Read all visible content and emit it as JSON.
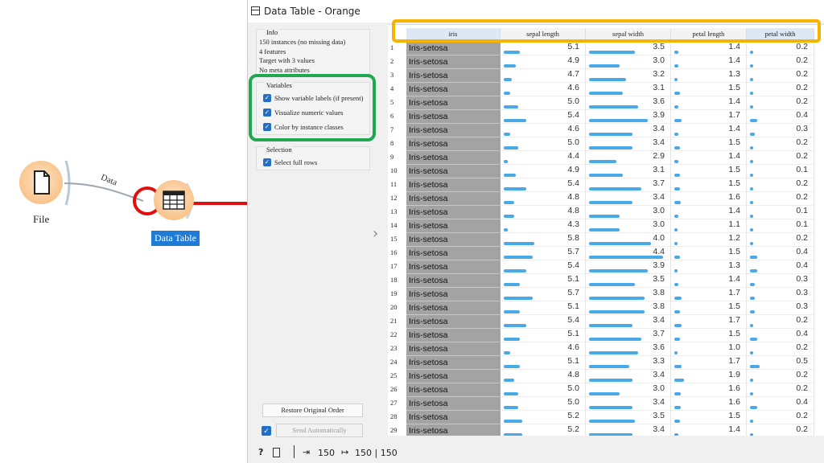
{
  "workflow": {
    "edge_label": "Data",
    "nodes": [
      {
        "label": "File",
        "icon": "file-icon"
      },
      {
        "label": "Data Table",
        "icon": "table-icon"
      }
    ]
  },
  "window": {
    "title": "Data Table - Orange"
  },
  "info": {
    "title": "Info",
    "lines": [
      "150 instances (no missing data)",
      "4 features",
      "Target with 3 values",
      "No meta attributes"
    ]
  },
  "variables": {
    "title": "Variables",
    "options": [
      {
        "label": "Show variable labels (if present)",
        "checked": true
      },
      {
        "label": "Visualize numeric values",
        "checked": true
      },
      {
        "label": "Color by instance classes",
        "checked": true
      }
    ]
  },
  "selection": {
    "title": "Selection",
    "options": [
      {
        "label": "Select full rows",
        "checked": true
      }
    ]
  },
  "buttons": {
    "restore": "Restore Original Order",
    "send": "Send Automatically"
  },
  "status": {
    "input_count": "150",
    "output_count": "150 | 150"
  },
  "colors": {
    "highlight_orange": "#f4b400",
    "highlight_green": "#1fa84f",
    "highlight_red": "#e01010",
    "bar_blue": "#49a9e6",
    "class_gray": "#a3a3a3"
  },
  "table": {
    "columns": [
      "iris",
      "sepal length",
      "sepal width",
      "petal length",
      "petal width"
    ],
    "rows": [
      {
        "n": "1",
        "iris": "Iris-setosa",
        "v": [
          "5.1",
          "3.5",
          "1.4",
          "0.2"
        ]
      },
      {
        "n": "2",
        "iris": "Iris-setosa",
        "v": [
          "4.9",
          "3.0",
          "1.4",
          "0.2"
        ]
      },
      {
        "n": "3",
        "iris": "Iris-setosa",
        "v": [
          "4.7",
          "3.2",
          "1.3",
          "0.2"
        ]
      },
      {
        "n": "4",
        "iris": "Iris-setosa",
        "v": [
          "4.6",
          "3.1",
          "1.5",
          "0.2"
        ]
      },
      {
        "n": "5",
        "iris": "Iris-setosa",
        "v": [
          "5.0",
          "3.6",
          "1.4",
          "0.2"
        ]
      },
      {
        "n": "6",
        "iris": "Iris-setosa",
        "v": [
          "5.4",
          "3.9",
          "1.7",
          "0.4"
        ]
      },
      {
        "n": "7",
        "iris": "Iris-setosa",
        "v": [
          "4.6",
          "3.4",
          "1.4",
          "0.3"
        ]
      },
      {
        "n": "8",
        "iris": "Iris-setosa",
        "v": [
          "5.0",
          "3.4",
          "1.5",
          "0.2"
        ]
      },
      {
        "n": "9",
        "iris": "Iris-setosa",
        "v": [
          "4.4",
          "2.9",
          "1.4",
          "0.2"
        ]
      },
      {
        "n": "10",
        "iris": "Iris-setosa",
        "v": [
          "4.9",
          "3.1",
          "1.5",
          "0.1"
        ]
      },
      {
        "n": "11",
        "iris": "Iris-setosa",
        "v": [
          "5.4",
          "3.7",
          "1.5",
          "0.2"
        ]
      },
      {
        "n": "12",
        "iris": "Iris-setosa",
        "v": [
          "4.8",
          "3.4",
          "1.6",
          "0.2"
        ]
      },
      {
        "n": "13",
        "iris": "Iris-setosa",
        "v": [
          "4.8",
          "3.0",
          "1.4",
          "0.1"
        ]
      },
      {
        "n": "14",
        "iris": "Iris-setosa",
        "v": [
          "4.3",
          "3.0",
          "1.1",
          "0.1"
        ]
      },
      {
        "n": "15",
        "iris": "Iris-setosa",
        "v": [
          "5.8",
          "4.0",
          "1.2",
          "0.2"
        ]
      },
      {
        "n": "16",
        "iris": "Iris-setosa",
        "v": [
          "5.7",
          "4.4",
          "1.5",
          "0.4"
        ]
      },
      {
        "n": "17",
        "iris": "Iris-setosa",
        "v": [
          "5.4",
          "3.9",
          "1.3",
          "0.4"
        ]
      },
      {
        "n": "18",
        "iris": "Iris-setosa",
        "v": [
          "5.1",
          "3.5",
          "1.4",
          "0.3"
        ]
      },
      {
        "n": "19",
        "iris": "Iris-setosa",
        "v": [
          "5.7",
          "3.8",
          "1.7",
          "0.3"
        ]
      },
      {
        "n": "20",
        "iris": "Iris-setosa",
        "v": [
          "5.1",
          "3.8",
          "1.5",
          "0.3"
        ]
      },
      {
        "n": "21",
        "iris": "Iris-setosa",
        "v": [
          "5.4",
          "3.4",
          "1.7",
          "0.2"
        ]
      },
      {
        "n": "22",
        "iris": "Iris-setosa",
        "v": [
          "5.1",
          "3.7",
          "1.5",
          "0.4"
        ]
      },
      {
        "n": "23",
        "iris": "Iris-setosa",
        "v": [
          "4.6",
          "3.6",
          "1.0",
          "0.2"
        ]
      },
      {
        "n": "24",
        "iris": "Iris-setosa",
        "v": [
          "5.1",
          "3.3",
          "1.7",
          "0.5"
        ]
      },
      {
        "n": "25",
        "iris": "Iris-setosa",
        "v": [
          "4.8",
          "3.4",
          "1.9",
          "0.2"
        ]
      },
      {
        "n": "26",
        "iris": "Iris-setosa",
        "v": [
          "5.0",
          "3.0",
          "1.6",
          "0.2"
        ]
      },
      {
        "n": "27",
        "iris": "Iris-setosa",
        "v": [
          "5.0",
          "3.4",
          "1.6",
          "0.4"
        ]
      },
      {
        "n": "28",
        "iris": "Iris-setosa",
        "v": [
          "5.2",
          "3.5",
          "1.5",
          "0.2"
        ]
      },
      {
        "n": "29",
        "iris": "Iris-setosa",
        "v": [
          "5.2",
          "3.4",
          "1.4",
          "0.2"
        ]
      }
    ]
  }
}
